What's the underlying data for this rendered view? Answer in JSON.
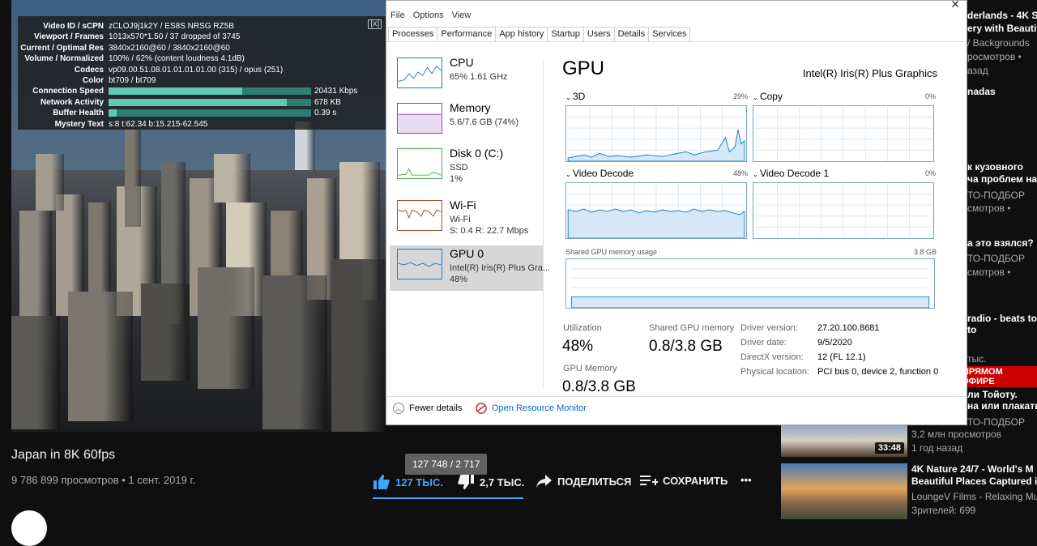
{
  "stats": {
    "close": "[x]",
    "rows": [
      {
        "k": "Video ID / sCPN",
        "v": "zCLOJ9j1k2Y / ES8S NRSG RZ5B"
      },
      {
        "k": "Viewport / Frames",
        "v": "1013x570*1.50 / 37 dropped of 3745"
      },
      {
        "k": "Current / Optimal Res",
        "v": "3840x2160@60 / 3840x2160@60"
      },
      {
        "k": "Volume / Normalized",
        "v": "100% / 62% (content loudness 4.1dB)"
      },
      {
        "k": "Codecs",
        "v": "vp09.00.51.08.01.01.01.01.00 (315) / opus (251)"
      },
      {
        "k": "Color",
        "v": "bt709 / bt709"
      }
    ],
    "bars": [
      {
        "k": "Connection Speed",
        "v": "20431 Kbps",
        "fill": 0.66
      },
      {
        "k": "Network Activity",
        "v": "678 KB",
        "fill": 0.88
      },
      {
        "k": "Buffer Health",
        "v": "0.39 s",
        "fill": 0.04
      }
    ],
    "mystery": {
      "k": "Mystery Text",
      "v": "s:8 t:62.34 b:15.215-62.545"
    }
  },
  "video": {
    "title": "Japan in 8K 60fps",
    "meta": "9 786 899 просмотров • 1 сент. 2019 г.",
    "tooltip": "127 748 / 2 717",
    "like": "127 ТЫС.",
    "dislike": "2,7 ТЫС.",
    "share": "ПОДЕЛИТЬСЯ",
    "save": "СОХРАНИТЬ",
    "more": "•••"
  },
  "taskmanager": {
    "menu": [
      "File",
      "Options",
      "View"
    ],
    "tabs": [
      "Processes",
      "Performance",
      "App history",
      "Startup",
      "Users",
      "Details",
      "Services"
    ],
    "active_tab": "Performance",
    "close": "✕",
    "perf": [
      {
        "name": "CPU",
        "l1": "65%  1.61 GHz",
        "l2": "",
        "color": "#1a7fc4"
      },
      {
        "name": "Memory",
        "l1": "5.6/7.6 GB (74%)",
        "l2": "",
        "color": "#8e44ad"
      },
      {
        "name": "Disk 0 (C:)",
        "l1": "SSD",
        "l2": "1%",
        "color": "#4caf50"
      },
      {
        "name": "Wi-Fi",
        "l1": "Wi-Fi",
        "l2": "S: 0.4  R: 22.7 Mbps",
        "color": "#a0522d"
      },
      {
        "name": "GPU 0",
        "l1": "Intel(R) Iris(R) Plus Gra...",
        "l2": "48%",
        "color": "#1a7fc4"
      }
    ],
    "gpu": {
      "title": "GPU",
      "model": "Intel(R) Iris(R) Plus Graphics",
      "engines": [
        {
          "name": "3D",
          "pct": "29%"
        },
        {
          "name": "Copy",
          "pct": "0%"
        },
        {
          "name": "Video Decode",
          "pct": "48%"
        },
        {
          "name": "Video Decode 1",
          "pct": "0%"
        }
      ],
      "shared_label": "Shared GPU memory usage",
      "shared_max": "3.8 GB",
      "utilization_label": "Utilization",
      "utilization": "48%",
      "shared_mem_label": "Shared GPU memory",
      "shared_mem": "0.8/3.8 GB",
      "gpu_mem_label": "GPU Memory",
      "gpu_mem": "0.8/3.8 GB",
      "driver": [
        {
          "k": "Driver version:",
          "v": "27.20.100.8681"
        },
        {
          "k": "Driver date:",
          "v": "9/5/2020"
        },
        {
          "k": "DirectX version:",
          "v": "12 (FL 12.1)"
        },
        {
          "k": "Physical location:",
          "v": "PCI bus 0, device 2, function 0"
        }
      ]
    },
    "footer": {
      "fewer": "Fewer details",
      "orm": "Open Resource Monitor"
    }
  },
  "sidebar": {
    "items": [
      {
        "text": "derlands - 4K S",
        "cls": "t"
      },
      {
        "text": "ery with Beautif",
        "cls": "t"
      },
      {
        "text": "/ Backgrounds",
        "cls": "g"
      },
      {
        "text": "росмотров •",
        "cls": "g"
      },
      {
        "text": "азад",
        "cls": "g"
      },
      {
        "text": "nadas",
        "cls": "t"
      },
      {
        "text": "к кузовного",
        "cls": "t"
      },
      {
        "text": "ча проблем на",
        "cls": "t"
      },
      {
        "text": "ТО-ПОДБОР",
        "cls": "g"
      },
      {
        "text": "смотров •",
        "cls": "g"
      },
      {
        "text": "а это взялся?",
        "cls": "t"
      },
      {
        "text": "ТО-ПОДБОР",
        "cls": "g"
      },
      {
        "text": "смотров •",
        "cls": "g"
      },
      {
        "text": "radio - beats to",
        "cls": "t"
      },
      {
        "text": "to",
        "cls": "t"
      },
      {
        "text": "тыс.",
        "cls": "g"
      },
      {
        "text": "ли Тойоту.",
        "cls": "t"
      },
      {
        "text": "на или плакать?",
        "cls": "t"
      },
      {
        "text": "ТО-ПОДБОР",
        "cls": "g"
      }
    ],
    "live": "ПРЯМОМ ЭФИРЕ",
    "v1_views": "3,2 млн просмотров",
    "v1_age": "1 год назад",
    "v1_duration": "33:48",
    "v2_title1": "4K Nature 24/7 - World's M",
    "v2_title2": "Beautiful Places Captured i",
    "v2_channel": "LoungeV Films - Relaxing Mu",
    "v2_viewers": "Зрителей: 699"
  }
}
